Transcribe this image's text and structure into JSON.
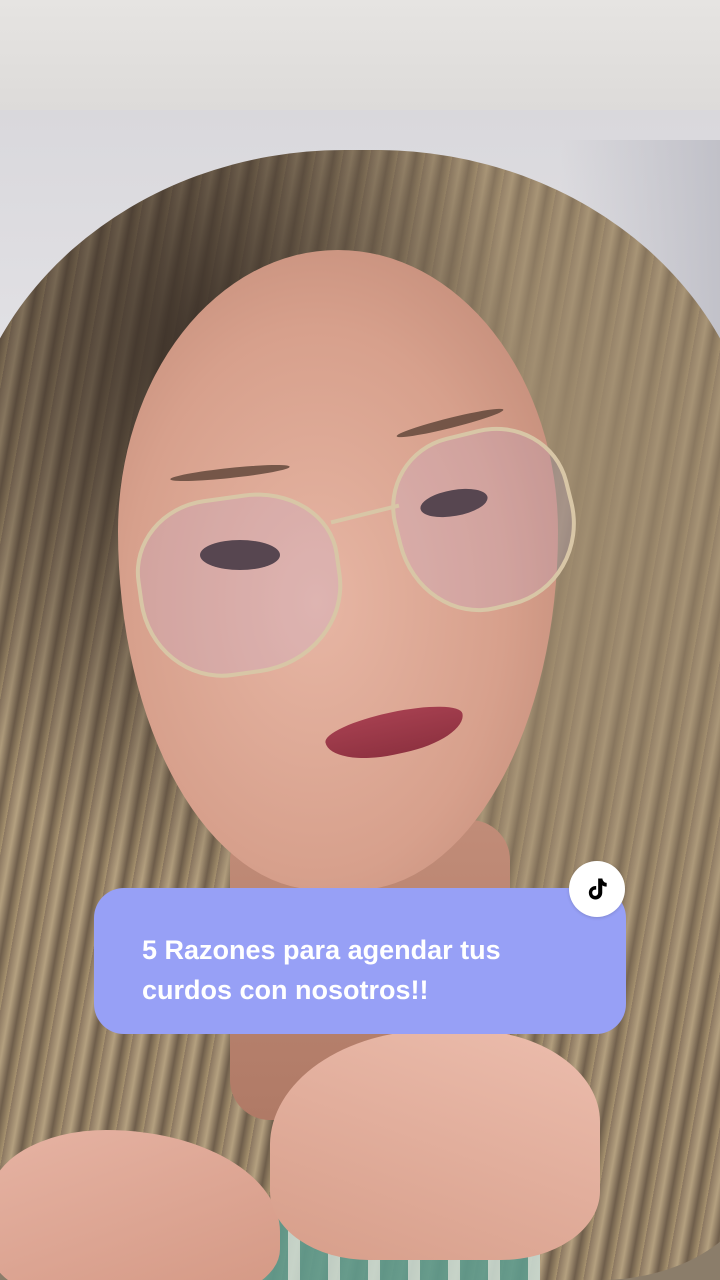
{
  "caption": {
    "text": "5  Razones para agendar tus\ncurdos con nosotros!!",
    "background_color": "#97a0f6",
    "text_color": "#ffffff"
  },
  "badge": {
    "icon": "tiktok-logo-icon"
  }
}
